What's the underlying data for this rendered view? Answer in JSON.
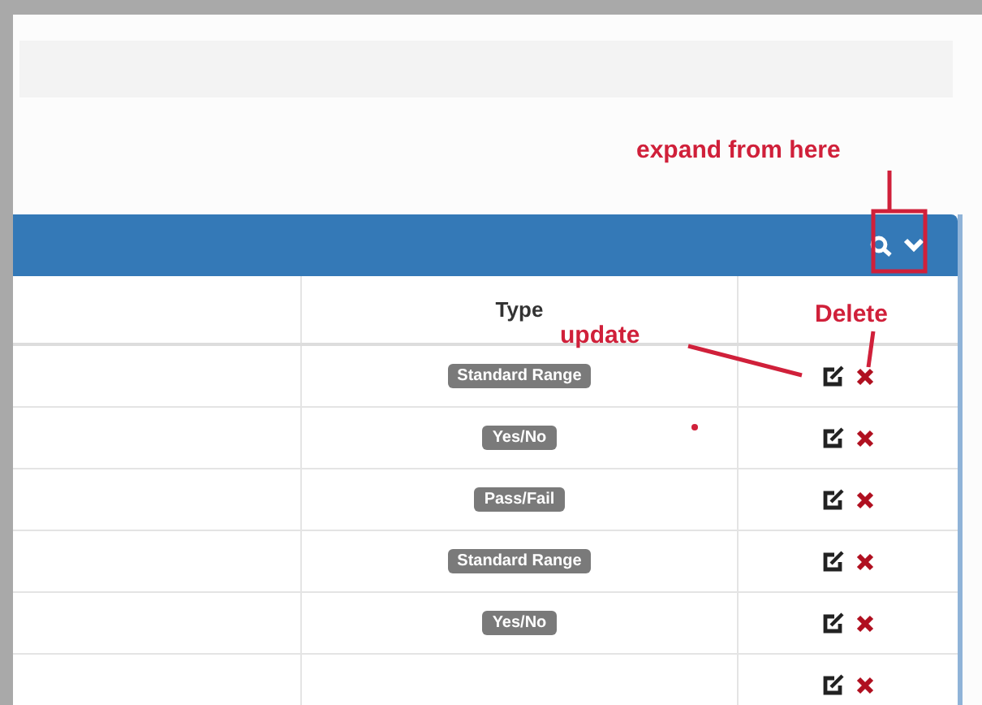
{
  "table": {
    "type_heading": "Type",
    "rows": [
      {
        "type": "Standard Range"
      },
      {
        "type": "Yes/No"
      },
      {
        "type": "Pass/Fail"
      },
      {
        "type": "Standard Range"
      },
      {
        "type": "Yes/No"
      },
      {}
    ]
  },
  "annotations": [
    {
      "kind": "expand",
      "text": "expand from here"
    },
    {
      "kind": "update",
      "text": "update"
    },
    {
      "kind": "delete",
      "text": "Delete"
    }
  ]
}
